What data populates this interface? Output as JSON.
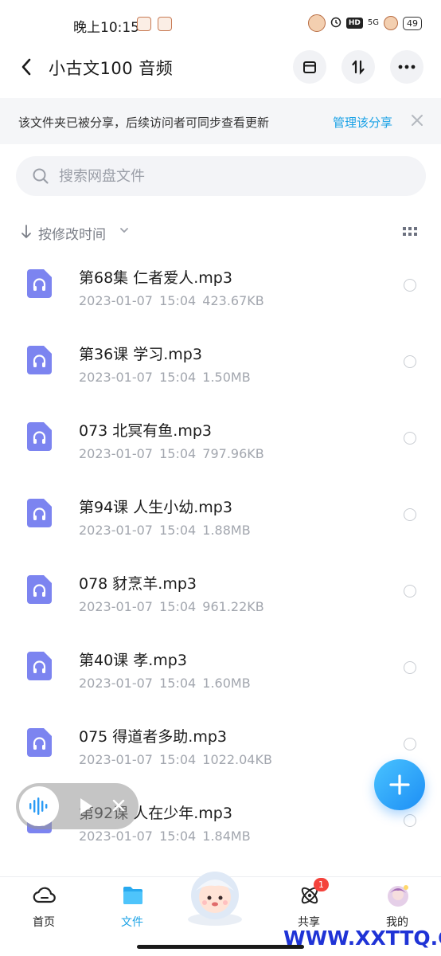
{
  "status_bar": {
    "time": "晚上10:15",
    "network": "5G",
    "hd": "HD",
    "battery": "49"
  },
  "header": {
    "title": "小古文100 音频"
  },
  "share_banner": {
    "text": "该文件夹已被分享，后续访问者可同步查看更新",
    "manage_label": "管理该分享"
  },
  "search": {
    "placeholder": "搜索网盘文件"
  },
  "sort": {
    "label": "按修改时间"
  },
  "files": [
    {
      "name": "第68集 仁者爱人.mp3",
      "date": "2023-01-07",
      "time": "15:04",
      "size": "423.67KB"
    },
    {
      "name": "第36课 学习.mp3",
      "date": "2023-01-07",
      "time": "15:04",
      "size": "1.50MB"
    },
    {
      "name": "073 北冥有鱼.mp3",
      "date": "2023-01-07",
      "time": "15:04",
      "size": "797.96KB"
    },
    {
      "name": "第94课 人生小幼.mp3",
      "date": "2023-01-07",
      "time": "15:04",
      "size": "1.88MB"
    },
    {
      "name": "078 豺烹羊.mp3",
      "date": "2023-01-07",
      "time": "15:04",
      "size": "961.22KB"
    },
    {
      "name": "第40课 孝.mp3",
      "date": "2023-01-07",
      "time": "15:04",
      "size": "1.60MB"
    },
    {
      "name": "075 得道者多助.mp3",
      "date": "2023-01-07",
      "time": "15:04",
      "size": "1022.04KB"
    },
    {
      "name": "第92课 人在少年.mp3",
      "date": "2023-01-07",
      "time": "15:04",
      "size": "1.84MB"
    }
  ],
  "nav": [
    {
      "label": "首页",
      "icon": "cloud-icon"
    },
    {
      "label": "文件",
      "icon": "folder-icon"
    },
    {
      "label": "共享",
      "icon": "share-atom-icon",
      "badge": "1"
    },
    {
      "label": "我的",
      "icon": "avatar"
    }
  ],
  "watermark": "WWW.XXTTQ.COM",
  "colors": {
    "accent": "#1aa2e6",
    "file_icon": "#7c84f0",
    "fab": "#2a9bf5",
    "badge": "#f4433c"
  }
}
